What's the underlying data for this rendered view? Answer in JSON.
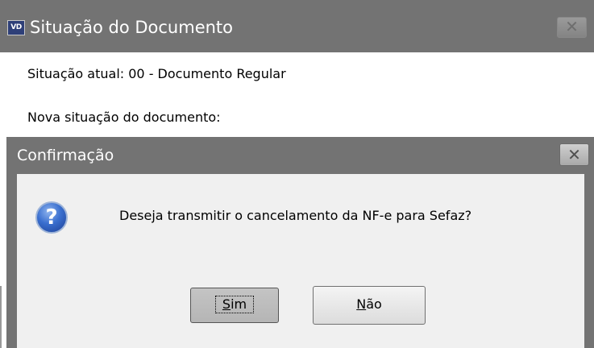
{
  "background_window": {
    "logo_text": "VD",
    "title": "Situação do Documento",
    "close_symbol": "✕",
    "situacao_atual": "Situação atual: 00 - Documento Regular",
    "nova_situacao_label": "Nova situação do documento:"
  },
  "dialog": {
    "title": "Confirmação",
    "close_symbol": "✕",
    "icon": "question-icon",
    "icon_glyph": "?",
    "message": "Deseja transmitir o cancelamento da NF-e para Sefaz?",
    "buttons": {
      "yes_accel": "S",
      "yes_rest": "im",
      "no_accel": "N",
      "no_rest": "ão"
    }
  },
  "colors": {
    "titlebar": "#737373",
    "dialog_body": "#f0f0f0"
  }
}
